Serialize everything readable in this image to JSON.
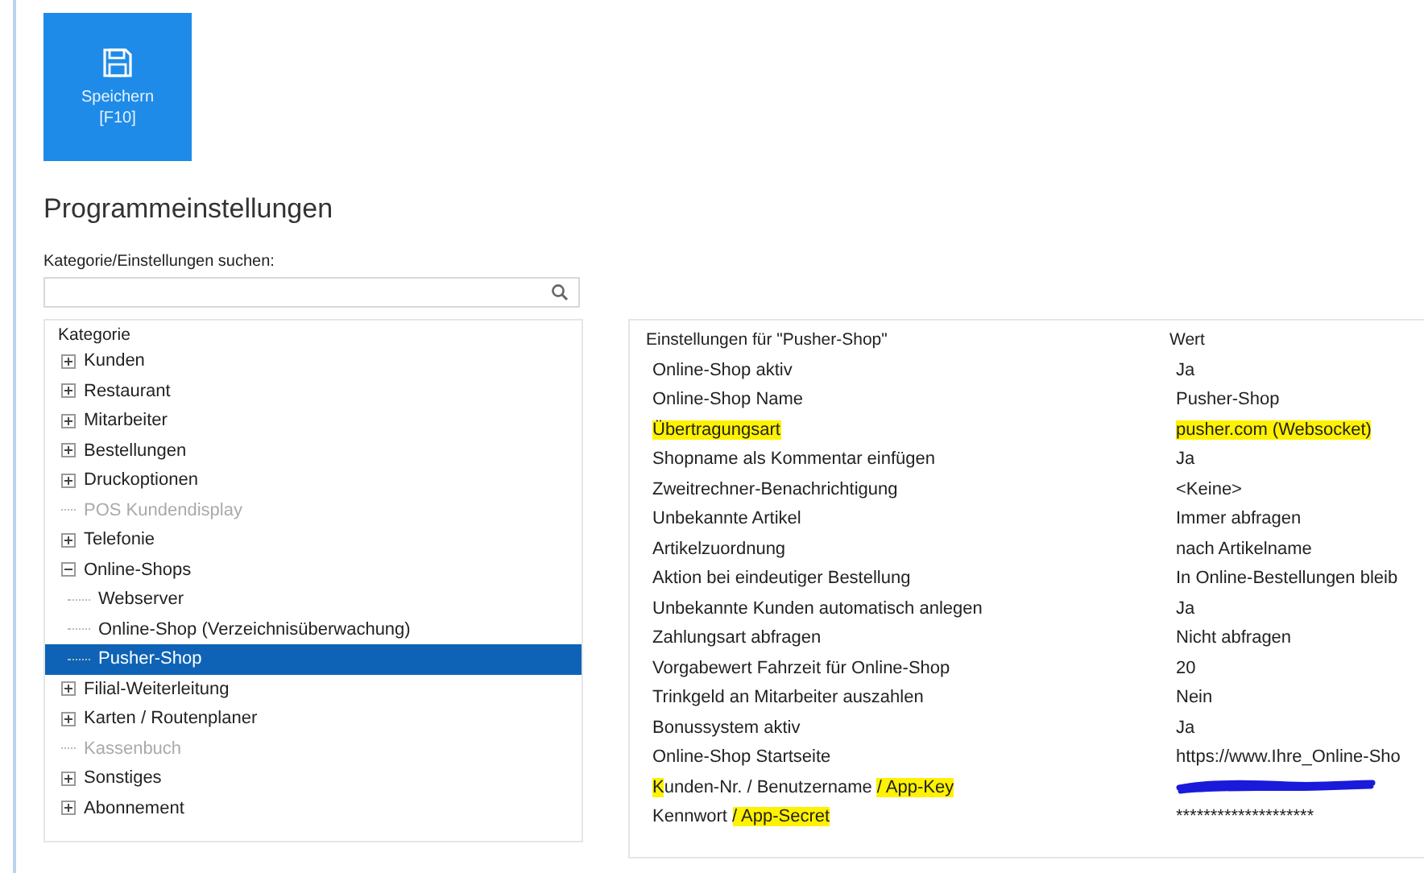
{
  "toolbar": {
    "save_button": {
      "label": "Speichern",
      "shortcut": "[F10]"
    }
  },
  "title": "Programmeinstellungen",
  "search": {
    "label": "Kategorie/Einstellungen suchen:"
  },
  "tree": {
    "header": "Kategorie",
    "items": [
      {
        "label": "Kunden",
        "expanded": false,
        "disabled": false,
        "selected": false
      },
      {
        "label": "Restaurant",
        "expanded": false,
        "disabled": false,
        "selected": false
      },
      {
        "label": "Mitarbeiter",
        "expanded": false,
        "disabled": false,
        "selected": false
      },
      {
        "label": "Bestellungen",
        "expanded": false,
        "disabled": false,
        "selected": false
      },
      {
        "label": "Druckoptionen",
        "expanded": false,
        "disabled": false,
        "selected": false
      },
      {
        "label": "POS Kundendisplay",
        "disabled": true,
        "selected": false
      },
      {
        "label": "Telefonie",
        "expanded": false,
        "disabled": false,
        "selected": false
      },
      {
        "label": "Online-Shops",
        "expanded": true,
        "disabled": false,
        "selected": false,
        "children": [
          {
            "label": "Webserver",
            "disabled": false,
            "selected": false
          },
          {
            "label": "Online-Shop (Verzeichnisüberwachung)",
            "disabled": false,
            "selected": false
          },
          {
            "label": "Pusher-Shop",
            "disabled": false,
            "selected": true
          }
        ]
      },
      {
        "label": "Filial-Weiterleitung",
        "expanded": false,
        "disabled": false,
        "selected": false
      },
      {
        "label": "Karten / Routenplaner",
        "expanded": false,
        "disabled": false,
        "selected": false
      },
      {
        "label": "Kassenbuch",
        "disabled": true,
        "selected": false
      },
      {
        "label": "Sonstiges",
        "expanded": false,
        "disabled": false,
        "selected": false
      },
      {
        "label": "Abonnement",
        "expanded": false,
        "disabled": false,
        "selected": false
      }
    ]
  },
  "settings": {
    "columns": [
      "Einstellungen für \"Pusher-Shop\"",
      "Wert"
    ],
    "rows": [
      {
        "label": [
          {
            "text": "Online-Shop aktiv",
            "highlight": false
          }
        ],
        "value": {
          "kind": "text",
          "text": "Ja",
          "highlight": false
        }
      },
      {
        "label": [
          {
            "text": "Online-Shop Name",
            "highlight": false
          }
        ],
        "value": {
          "kind": "text",
          "text": "Pusher-Shop",
          "highlight": false
        }
      },
      {
        "label": [
          {
            "text": "Übertragungsart",
            "highlight": true
          }
        ],
        "value": {
          "kind": "text",
          "text": "pusher.com (Websocket)",
          "highlight": true
        }
      },
      {
        "label": [
          {
            "text": "Shopname als Kommentar einfügen",
            "highlight": false
          }
        ],
        "value": {
          "kind": "text",
          "text": "Ja",
          "highlight": false
        }
      },
      {
        "label": [
          {
            "text": "Zweitrechner-Benachrichtigung",
            "highlight": false
          }
        ],
        "value": {
          "kind": "text",
          "text": "<Keine>",
          "highlight": false
        }
      },
      {
        "label": [
          {
            "text": "Unbekannte Artikel",
            "highlight": false
          }
        ],
        "value": {
          "kind": "text",
          "text": "Immer abfragen",
          "highlight": false
        }
      },
      {
        "label": [
          {
            "text": "Artikelzuordnung",
            "highlight": false
          }
        ],
        "value": {
          "kind": "text",
          "text": "nach Artikelname",
          "highlight": false
        }
      },
      {
        "label": [
          {
            "text": "Aktion bei eindeutiger Bestellung",
            "highlight": false
          }
        ],
        "value": {
          "kind": "text",
          "text": "In Online-Bestellungen bleib",
          "highlight": false
        }
      },
      {
        "label": [
          {
            "text": "Unbekannte Kunden automatisch anlegen",
            "highlight": false
          }
        ],
        "value": {
          "kind": "text",
          "text": "Ja",
          "highlight": false
        }
      },
      {
        "label": [
          {
            "text": "Zahlungsart abfragen",
            "highlight": false
          }
        ],
        "value": {
          "kind": "text",
          "text": "Nicht abfragen",
          "highlight": false
        }
      },
      {
        "label": [
          {
            "text": "Vorgabewert Fahrzeit für Online-Shop",
            "highlight": false
          }
        ],
        "value": {
          "kind": "text",
          "text": "20",
          "highlight": false
        }
      },
      {
        "label": [
          {
            "text": "Trinkgeld an Mitarbeiter auszahlen",
            "highlight": false
          }
        ],
        "value": {
          "kind": "text",
          "text": "Nein",
          "highlight": false
        }
      },
      {
        "label": [
          {
            "text": "Bonussystem aktiv",
            "highlight": false
          }
        ],
        "value": {
          "kind": "text",
          "text": "Ja",
          "highlight": false
        }
      },
      {
        "label": [
          {
            "text": "Online-Shop Startseite",
            "highlight": false
          }
        ],
        "value": {
          "kind": "text",
          "text": "https://www.Ihre_Online-Sho",
          "highlight": false
        }
      },
      {
        "label": [
          {
            "text": "K",
            "highlight": true
          },
          {
            "text": "unden-Nr. / Benutzername ",
            "highlight": false
          },
          {
            "text": "/ App-Key",
            "highlight": true
          }
        ],
        "value": {
          "kind": "redacted"
        }
      },
      {
        "label": [
          {
            "text": "Kennwort ",
            "highlight": false
          },
          {
            "text": "/ App-Secret",
            "highlight": true
          }
        ],
        "value": {
          "kind": "text",
          "text": "********************",
          "highlight": false
        }
      }
    ]
  }
}
